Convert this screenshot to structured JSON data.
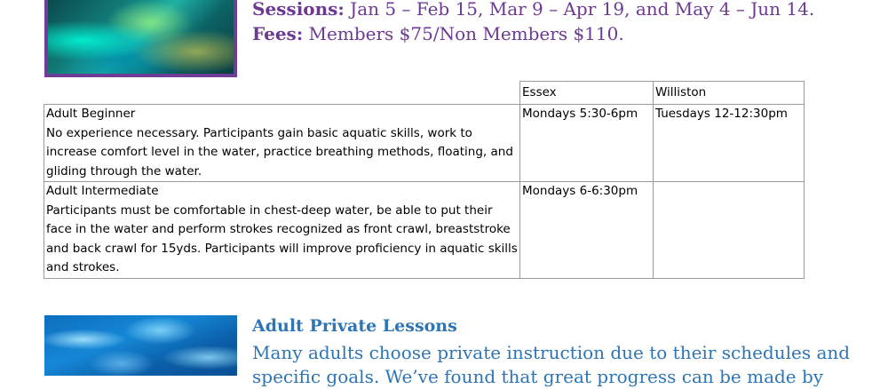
{
  "schedule": {
    "sessions_label": "Sessions:",
    "sessions_text": " Jan 5 – Feb 15, Mar 9 – Apr 19, and May 4 – Jun 14.",
    "fees_label": "Fees:",
    "fees_text": " Members $75/Non Members $110."
  },
  "table": {
    "headers": [
      "Essex",
      "Williston"
    ],
    "rows": [
      {
        "title": "Adult Beginner",
        "description": "No experience necessary. Participants gain basic aquatic skills, work to increase comfort level in the water, practice breathing methods, floating, and gliding through the water.",
        "essex": "Mondays 5:30-6pm",
        "williston": "Tuesdays 12-12:30pm"
      },
      {
        "title": "Adult Intermediate",
        "description": "Participants must be comfortable in chest-deep water, be able to put their face in the water and perform strokes recognized as front crawl, breaststroke and back crawl for 15yds. Participants will improve proficiency in aquatic skills and strokes.",
        "essex": "Mondays 6-6:30pm",
        "williston": ""
      }
    ]
  },
  "private": {
    "title": "Adult Private Lessons",
    "body": "Many adults choose private instruction due to their schedules and specific goals. We’ve found that great progress can be made by"
  }
}
